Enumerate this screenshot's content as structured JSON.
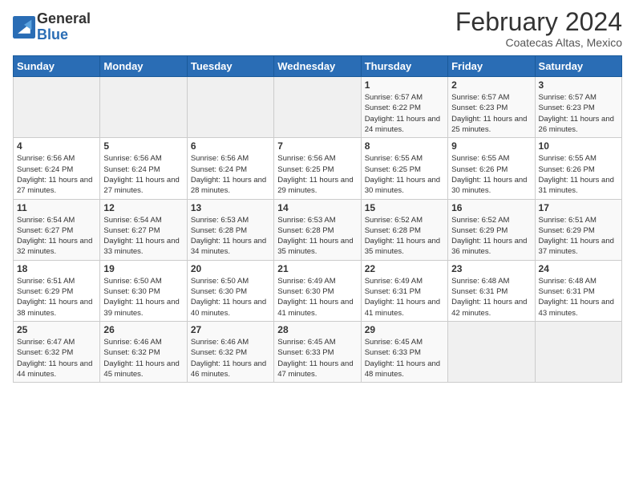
{
  "header": {
    "logo_general": "General",
    "logo_blue": "Blue",
    "month_title": "February 2024",
    "subtitle": "Coatecas Altas, Mexico"
  },
  "weekdays": [
    "Sunday",
    "Monday",
    "Tuesday",
    "Wednesday",
    "Thursday",
    "Friday",
    "Saturday"
  ],
  "weeks": [
    [
      {
        "day": "",
        "info": ""
      },
      {
        "day": "",
        "info": ""
      },
      {
        "day": "",
        "info": ""
      },
      {
        "day": "",
        "info": ""
      },
      {
        "day": "1",
        "info": "Sunrise: 6:57 AM\nSunset: 6:22 PM\nDaylight: 11 hours and 24 minutes."
      },
      {
        "day": "2",
        "info": "Sunrise: 6:57 AM\nSunset: 6:23 PM\nDaylight: 11 hours and 25 minutes."
      },
      {
        "day": "3",
        "info": "Sunrise: 6:57 AM\nSunset: 6:23 PM\nDaylight: 11 hours and 26 minutes."
      }
    ],
    [
      {
        "day": "4",
        "info": "Sunrise: 6:56 AM\nSunset: 6:24 PM\nDaylight: 11 hours and 27 minutes."
      },
      {
        "day": "5",
        "info": "Sunrise: 6:56 AM\nSunset: 6:24 PM\nDaylight: 11 hours and 27 minutes."
      },
      {
        "day": "6",
        "info": "Sunrise: 6:56 AM\nSunset: 6:24 PM\nDaylight: 11 hours and 28 minutes."
      },
      {
        "day": "7",
        "info": "Sunrise: 6:56 AM\nSunset: 6:25 PM\nDaylight: 11 hours and 29 minutes."
      },
      {
        "day": "8",
        "info": "Sunrise: 6:55 AM\nSunset: 6:25 PM\nDaylight: 11 hours and 30 minutes."
      },
      {
        "day": "9",
        "info": "Sunrise: 6:55 AM\nSunset: 6:26 PM\nDaylight: 11 hours and 30 minutes."
      },
      {
        "day": "10",
        "info": "Sunrise: 6:55 AM\nSunset: 6:26 PM\nDaylight: 11 hours and 31 minutes."
      }
    ],
    [
      {
        "day": "11",
        "info": "Sunrise: 6:54 AM\nSunset: 6:27 PM\nDaylight: 11 hours and 32 minutes."
      },
      {
        "day": "12",
        "info": "Sunrise: 6:54 AM\nSunset: 6:27 PM\nDaylight: 11 hours and 33 minutes."
      },
      {
        "day": "13",
        "info": "Sunrise: 6:53 AM\nSunset: 6:28 PM\nDaylight: 11 hours and 34 minutes."
      },
      {
        "day": "14",
        "info": "Sunrise: 6:53 AM\nSunset: 6:28 PM\nDaylight: 11 hours and 35 minutes."
      },
      {
        "day": "15",
        "info": "Sunrise: 6:52 AM\nSunset: 6:28 PM\nDaylight: 11 hours and 35 minutes."
      },
      {
        "day": "16",
        "info": "Sunrise: 6:52 AM\nSunset: 6:29 PM\nDaylight: 11 hours and 36 minutes."
      },
      {
        "day": "17",
        "info": "Sunrise: 6:51 AM\nSunset: 6:29 PM\nDaylight: 11 hours and 37 minutes."
      }
    ],
    [
      {
        "day": "18",
        "info": "Sunrise: 6:51 AM\nSunset: 6:29 PM\nDaylight: 11 hours and 38 minutes."
      },
      {
        "day": "19",
        "info": "Sunrise: 6:50 AM\nSunset: 6:30 PM\nDaylight: 11 hours and 39 minutes."
      },
      {
        "day": "20",
        "info": "Sunrise: 6:50 AM\nSunset: 6:30 PM\nDaylight: 11 hours and 40 minutes."
      },
      {
        "day": "21",
        "info": "Sunrise: 6:49 AM\nSunset: 6:30 PM\nDaylight: 11 hours and 41 minutes."
      },
      {
        "day": "22",
        "info": "Sunrise: 6:49 AM\nSunset: 6:31 PM\nDaylight: 11 hours and 41 minutes."
      },
      {
        "day": "23",
        "info": "Sunrise: 6:48 AM\nSunset: 6:31 PM\nDaylight: 11 hours and 42 minutes."
      },
      {
        "day": "24",
        "info": "Sunrise: 6:48 AM\nSunset: 6:31 PM\nDaylight: 11 hours and 43 minutes."
      }
    ],
    [
      {
        "day": "25",
        "info": "Sunrise: 6:47 AM\nSunset: 6:32 PM\nDaylight: 11 hours and 44 minutes."
      },
      {
        "day": "26",
        "info": "Sunrise: 6:46 AM\nSunset: 6:32 PM\nDaylight: 11 hours and 45 minutes."
      },
      {
        "day": "27",
        "info": "Sunrise: 6:46 AM\nSunset: 6:32 PM\nDaylight: 11 hours and 46 minutes."
      },
      {
        "day": "28",
        "info": "Sunrise: 6:45 AM\nSunset: 6:33 PM\nDaylight: 11 hours and 47 minutes."
      },
      {
        "day": "29",
        "info": "Sunrise: 6:45 AM\nSunset: 6:33 PM\nDaylight: 11 hours and 48 minutes."
      },
      {
        "day": "",
        "info": ""
      },
      {
        "day": "",
        "info": ""
      }
    ]
  ]
}
